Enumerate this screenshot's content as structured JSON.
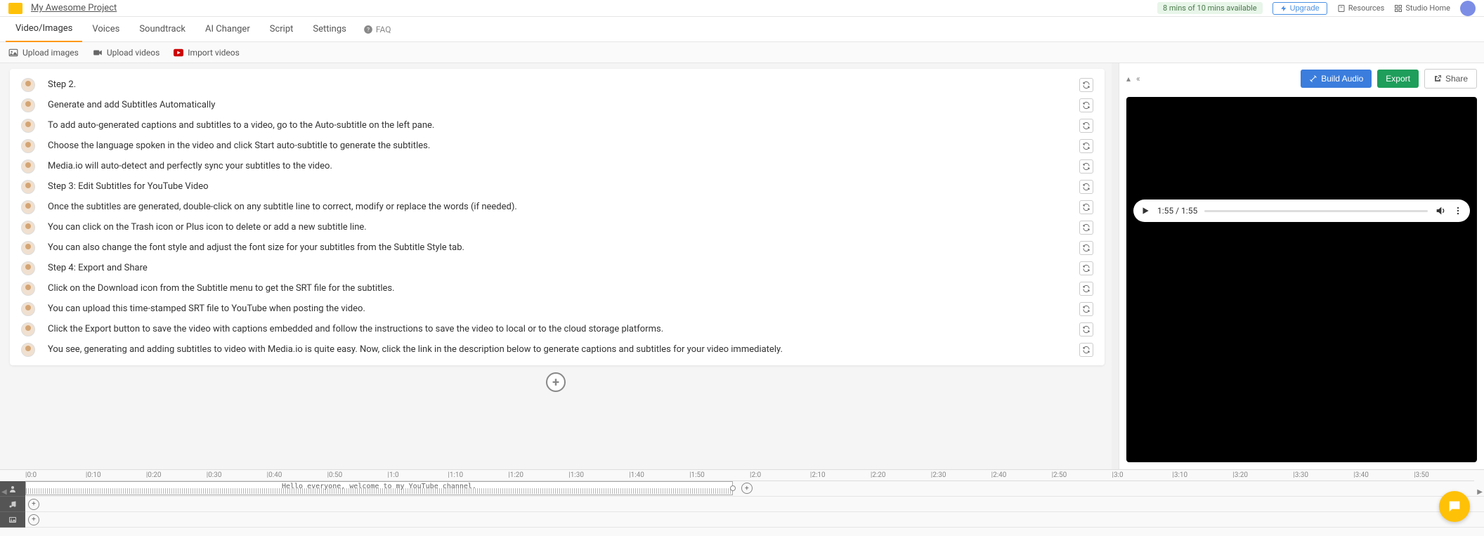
{
  "header": {
    "project_name": "My Awesome Project",
    "mins_badge": "8 mins of 10 mins available",
    "upgrade": "Upgrade",
    "resources": "Resources",
    "studio_home": "Studio Home"
  },
  "tabs": {
    "items": [
      "Video/Images",
      "Voices",
      "Soundtrack",
      "AI Changer",
      "Script",
      "Settings"
    ],
    "faq": "FAQ"
  },
  "toolbar": {
    "upload_images": "Upload images",
    "upload_videos": "Upload videos",
    "import_videos": "Import videos"
  },
  "script_lines": [
    "Step 2.",
    "Generate and add Subtitles Automatically",
    "To add auto-generated captions and subtitles to a video, go to the Auto-subtitle on the left pane.",
    "Choose the language spoken in the video and click Start auto-subtitle to generate the subtitles.",
    "Media.io will auto-detect and perfectly sync your subtitles to the video.",
    "Step 3: Edit Subtitles for YouTube Video",
    "Once the subtitles are generated, double-click on any subtitle line to correct, modify or replace the words (if needed).",
    "You can click on the Trash icon or Plus icon to delete or add a new subtitle line.",
    "You can also change the font style and adjust the font size for your subtitles from the Subtitle Style tab.",
    "Step 4: Export and Share",
    "Click on the Download icon from the Subtitle menu to get the SRT file for the subtitles.",
    "You can upload this time-stamped SRT file to YouTube when posting the video.",
    "Click the Export button to save the video with captions embedded and follow the instructions to save the video to local or to the cloud storage platforms.",
    "You see, generating and adding subtitles to video with Media.io is quite easy. Now, click the link in the description below to generate captions and subtitles for your video immediately."
  ],
  "right": {
    "build_audio": "Build Audio",
    "export": "Export",
    "share": "Share",
    "time": "1:55 / 1:55"
  },
  "timeline": {
    "ticks": [
      "0:0",
      "0:10",
      "0:20",
      "0:30",
      "0:40",
      "0:50",
      "1:0",
      "1:10",
      "1:20",
      "1:30",
      "1:40",
      "1:50",
      "2:0",
      "2:10",
      "2:20",
      "2:30",
      "2:40",
      "2:50",
      "3:0",
      "3:10",
      "3:20",
      "3:30",
      "3:40",
      "3:50"
    ],
    "clip_text": "Hello everyone, welcome to my YouTube channel.",
    "clip_width_pct": 48.5
  }
}
